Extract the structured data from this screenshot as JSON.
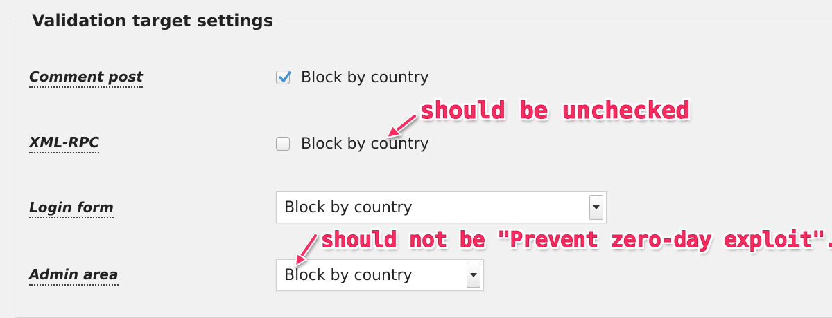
{
  "legend": "Validation target settings",
  "rows": {
    "comment_post": {
      "label": "Comment post",
      "checkbox_label": "Block by country",
      "checked": true
    },
    "xmlrpc": {
      "label": "XML-RPC",
      "checkbox_label": "Block by country",
      "checked": false
    },
    "login_form": {
      "label": "Login form",
      "selected": "Block by country"
    },
    "admin_area": {
      "label": "Admin area",
      "selected": "Block by country"
    }
  },
  "annotations": {
    "xmlrpc_note": "should be unchecked",
    "admin_note": "should not be \"Prevent zero-day exploit\"."
  },
  "colors": {
    "background": "#f1f1f1",
    "annotation": "#ff2a5f",
    "checkbox_checked": "#3d8fd6"
  }
}
